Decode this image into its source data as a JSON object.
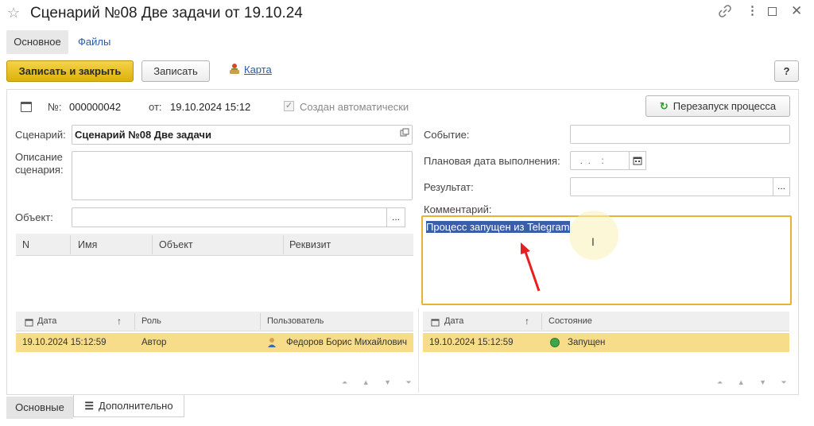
{
  "window": {
    "title": "Сценарий №08 Две задачи от 19.10.24",
    "star_icon": "star-icon",
    "link_icon": "link-icon",
    "more_icon": "more-icon",
    "maximize_icon": "maximize-icon",
    "close_icon": "close-icon"
  },
  "top_tabs": {
    "main": "Основное",
    "files": "Файлы"
  },
  "toolbar": {
    "save_close": "Записать и закрыть",
    "save": "Записать",
    "map": "Карта",
    "help": "?"
  },
  "header": {
    "number_label": "№:",
    "number": "000000042",
    "date_label": "от:",
    "date": "19.10.2024 15:12",
    "auto_created": "Создан автоматически",
    "restart": "Перезапуск процесса"
  },
  "form": {
    "scenario_label": "Сценарий:",
    "scenario_value": "Сценарий №08 Две задачи",
    "description_label_1": "Описание",
    "description_label_2": "сценария:",
    "object_label": "Объект:",
    "event_label": "Событие:",
    "planned_date_label": "Плановая дата выполнения:",
    "planned_date_value": "  .  .    :  ",
    "result_label": "Результат:",
    "comment_label": "Комментарий:",
    "comment_value": "Процесс запущен из Telegram",
    "dots": "..."
  },
  "attr_table": {
    "headers": [
      "N",
      "Имя",
      "Объект",
      "Реквизит"
    ]
  },
  "history_table": {
    "headers": [
      "Дата",
      "Роль",
      "Пользователь"
    ],
    "sort_icon": "↑",
    "rows": [
      {
        "date": "19.10.2024 15:12:59",
        "role": "Автор",
        "user": "Федоров Борис Михайлович"
      }
    ]
  },
  "state_table": {
    "headers": [
      "Дата",
      "Состояние"
    ],
    "sort_icon": "↑",
    "rows": [
      {
        "date": "19.10.2024 15:12:59",
        "state": "Запущен"
      }
    ]
  },
  "nav_arrows": "⏶ ▲ ▼ ⏷",
  "bottom_tabs": {
    "main": "Основные",
    "extra": "Дополнительно"
  },
  "colors": {
    "accent": "#f7dc8a",
    "primary_button": "#dcb10a",
    "focus": "#e6b432",
    "link": "#2a5aa8"
  }
}
